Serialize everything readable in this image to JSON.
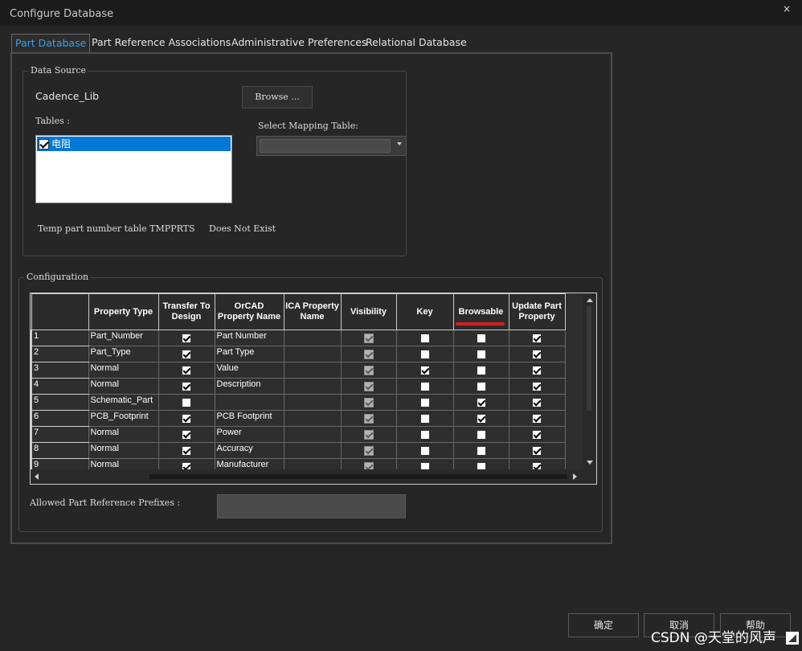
{
  "window": {
    "title": "Configure Database",
    "close_glyph": "×"
  },
  "tabs": [
    {
      "label": "Part Database",
      "active": true
    },
    {
      "label": "Part Reference Associations",
      "active": false
    },
    {
      "label": "Administrative Preferences",
      "active": false
    },
    {
      "label": "Relational Database",
      "active": false
    }
  ],
  "data_source": {
    "legend": "Data Source",
    "library_name": "Cadence_Lib",
    "browse_label": "Browse ...",
    "tables_label": "Tables :",
    "tables": [
      {
        "label": "电阻",
        "checked": true,
        "selected": true
      }
    ],
    "mapping_label": "Select Mapping Table:",
    "mapping_value": "",
    "temp_table_label": "Temp part number table TMPPRTS",
    "temp_table_status": "Does Not Exist"
  },
  "configuration": {
    "legend": "Configuration",
    "columns": [
      "",
      "Property Type",
      "Transfer To Design",
      "OrCAD Property Name",
      "ICA Property Name",
      "Visibility",
      "Key",
      "Browsable",
      "Update Part Property"
    ],
    "rows": [
      {
        "num": "1",
        "type": "Part_Number",
        "transfer": true,
        "orcad": "Part Number",
        "ica": "",
        "visibility": true,
        "key": false,
        "browsable": false,
        "update": true
      },
      {
        "num": "2",
        "type": "Part_Type",
        "transfer": true,
        "orcad": "Part Type",
        "ica": "",
        "visibility": true,
        "key": false,
        "browsable": false,
        "update": true
      },
      {
        "num": "3",
        "type": "Normal",
        "transfer": true,
        "orcad": "Value",
        "ica": "",
        "visibility": true,
        "key": true,
        "browsable": false,
        "update": true
      },
      {
        "num": "4",
        "type": "Normal",
        "transfer": true,
        "orcad": "Description",
        "ica": "",
        "visibility": true,
        "key": false,
        "browsable": false,
        "update": true
      },
      {
        "num": "5",
        "type": "Schematic_Part",
        "transfer": false,
        "orcad": "",
        "ica": "",
        "visibility": true,
        "key": false,
        "browsable": true,
        "update": true
      },
      {
        "num": "6",
        "type": "PCB_Footprint",
        "transfer": true,
        "orcad": "PCB Footprint",
        "ica": "",
        "visibility": true,
        "key": false,
        "browsable": true,
        "update": true
      },
      {
        "num": "7",
        "type": "Normal",
        "transfer": true,
        "orcad": "Power",
        "ica": "",
        "visibility": true,
        "key": false,
        "browsable": false,
        "update": true
      },
      {
        "num": "8",
        "type": "Normal",
        "transfer": true,
        "orcad": "Accuracy",
        "ica": "",
        "visibility": true,
        "key": false,
        "browsable": false,
        "update": true
      },
      {
        "num": "9",
        "type": "Normal",
        "transfer": true,
        "orcad": "Manufacturer",
        "ica": "",
        "visibility": true,
        "key": false,
        "browsable": false,
        "update": true
      }
    ],
    "prefixes_label": "Allowed Part Reference Prefixes :",
    "prefixes_value": ""
  },
  "buttons": {
    "ok": "确定",
    "cancel": "取消",
    "help": "帮助"
  },
  "watermark": "CSDN @天堂的风声",
  "colors": {
    "accent": "#3b9fe8",
    "selection": "#0078d7",
    "annotation_red": "#d01f1f",
    "background": "#262626"
  }
}
